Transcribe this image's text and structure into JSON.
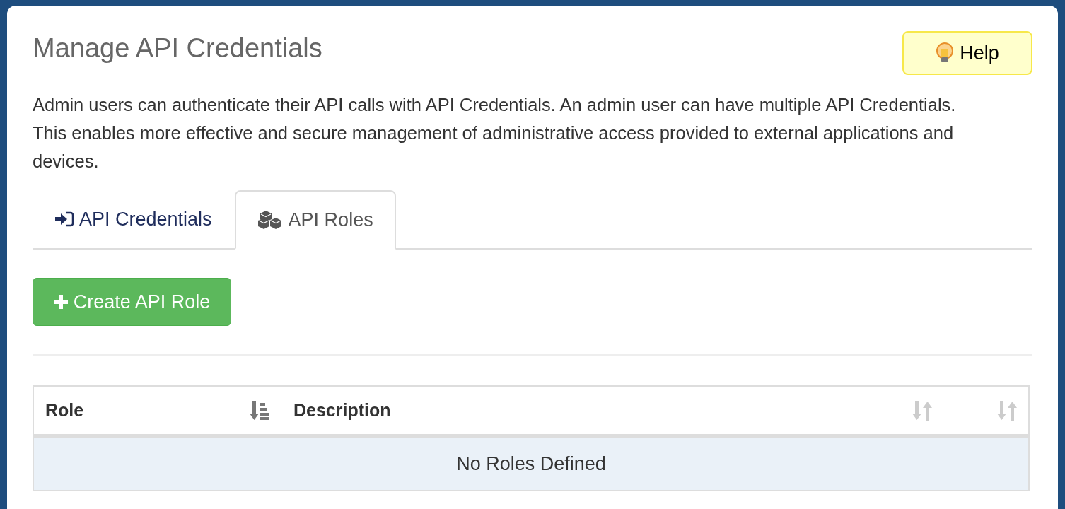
{
  "title": "Manage API Credentials",
  "help_button": {
    "label": "Help"
  },
  "description": "Admin users can authenticate their API calls with API Credentials. An admin user can have multiple API Credentials. This enables more effective and secure management of administrative access provided to external applications and devices.",
  "tabs": [
    {
      "label": "API Credentials",
      "kind": "signin",
      "selected": false
    },
    {
      "label": "API Roles",
      "kind": "cubes",
      "selected": true
    }
  ],
  "create_button": {
    "label": "Create API Role"
  },
  "table": {
    "columns": [
      {
        "label": "Role",
        "sorted": true
      },
      {
        "label": "Description",
        "sorted": false
      },
      {
        "sorted": false
      }
    ],
    "empty_message": "No Roles Defined"
  }
}
